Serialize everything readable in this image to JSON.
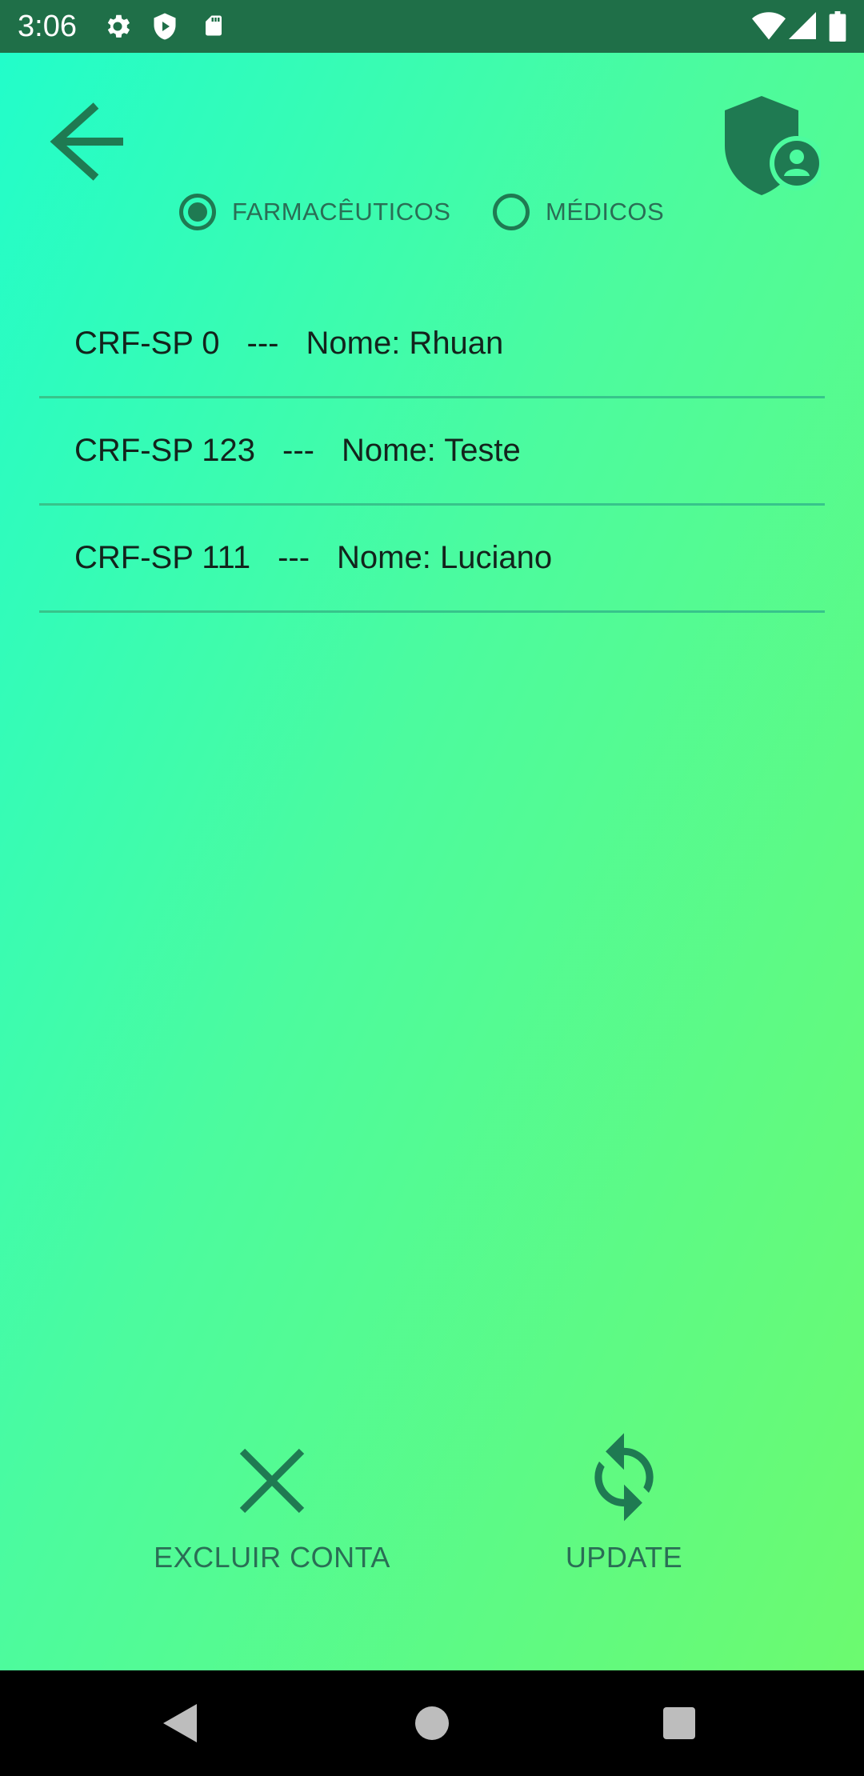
{
  "status_bar": {
    "time": "3:06",
    "icons_left": [
      "gear-icon",
      "shield-play-icon",
      "sd-card-icon"
    ],
    "icons_right": [
      "wifi-icon",
      "signal-icon",
      "battery-icon"
    ]
  },
  "header": {
    "back_icon": "arrow-left-icon",
    "profile_icon": "shield-account-icon"
  },
  "filter": {
    "options": [
      {
        "label": "FARMACÊUTICOS",
        "selected": true
      },
      {
        "label": "MÉDICOS",
        "selected": false
      }
    ]
  },
  "list": {
    "items": [
      {
        "crf": "CRF-SP 0",
        "sep": "---",
        "name": "Nome: Rhuan"
      },
      {
        "crf": "CRF-SP 123",
        "sep": "---",
        "name": "Nome: Teste"
      },
      {
        "crf": "CRF-SP 111",
        "sep": "---",
        "name": "Nome: Luciano"
      }
    ]
  },
  "actions": {
    "delete_label": "EXCLUIR CONTA",
    "update_label": "UPDATE"
  },
  "colors": {
    "accent": "#1f7a52",
    "status_bar": "#1f6f48",
    "gradient_start": "#22fdca",
    "gradient_end": "#6cfa6f"
  }
}
